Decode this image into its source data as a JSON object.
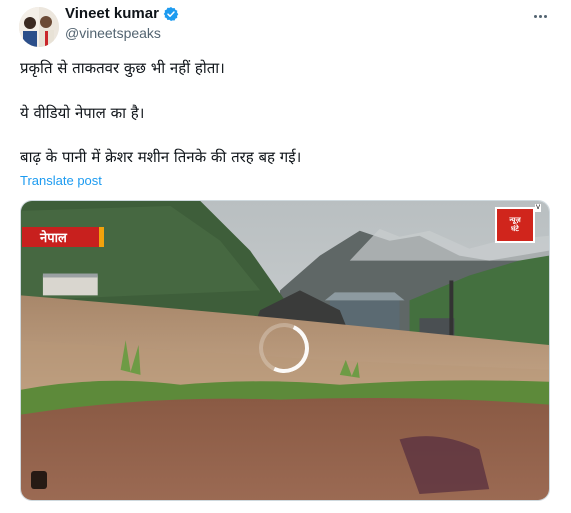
{
  "author": {
    "name": "Vineet kumar",
    "handle": "@vineetspeaks",
    "verified": true,
    "verified_color": "#1d9bf0"
  },
  "post": {
    "lines": [
      "प्रकृति से ताकतवर कुछ भी नहीं होता।",
      "ये वीडियो नेपाल का है।",
      "बाढ़ के पानी में क्रेशर मशीन तिनके की तरह बह गई।"
    ],
    "translate_label": "Translate post"
  },
  "video": {
    "location_tag": "नेपाल",
    "channel_logo_text": [
      "न्यूज़",
      "घंटे"
    ],
    "channel_logo_badge": "V",
    "state": "loading",
    "tag_color": "#c8201e",
    "logo_color": "#d0251c"
  },
  "icons": {
    "more": "more-options-icon",
    "verified": "verified-badge-icon",
    "loading": "loading-spinner-icon"
  }
}
